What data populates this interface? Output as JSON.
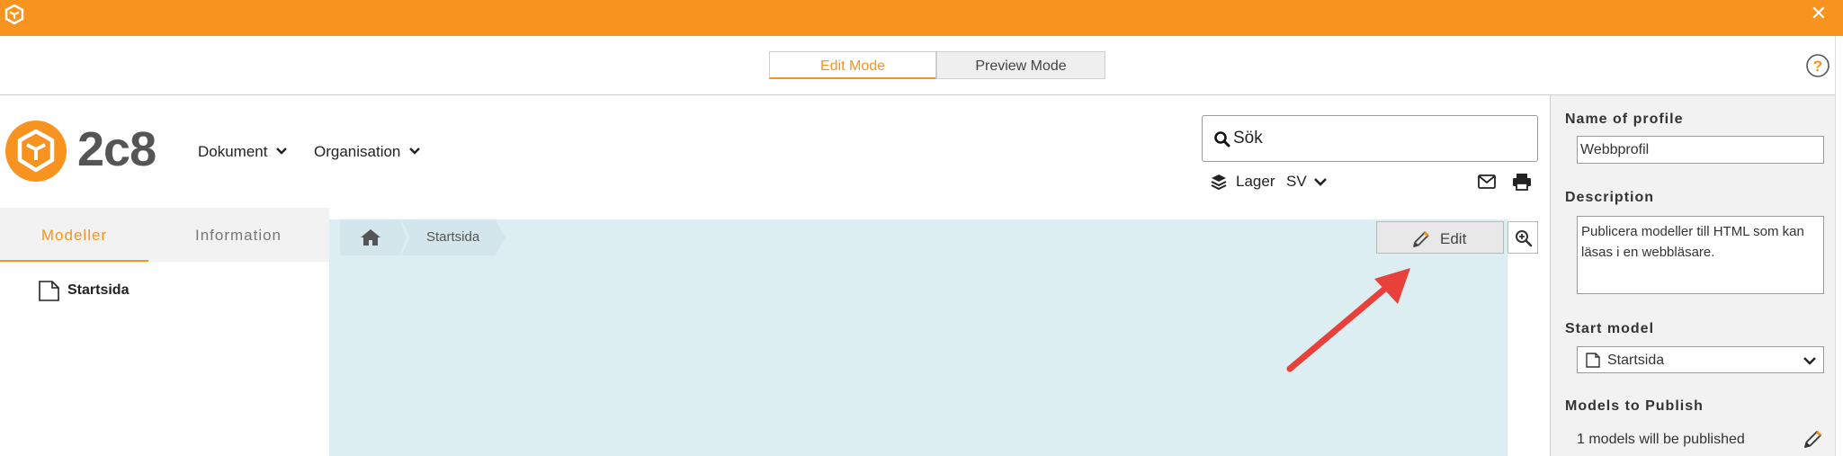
{
  "app": {
    "brand_name": "2c8",
    "accent_color": "#f7931e",
    "close_icon": "close-icon"
  },
  "modes": {
    "edit_label": "Edit Mode",
    "preview_label": "Preview Mode",
    "active": "Edit Mode"
  },
  "header": {
    "nav": [
      {
        "label": "Dokument"
      },
      {
        "label": "Organisation"
      }
    ],
    "search": {
      "placeholder": "Sök",
      "value": ""
    },
    "layers_label": "Lager",
    "language": "SV"
  },
  "sidebar": {
    "tabs": [
      {
        "label": "Modeller",
        "active": true
      },
      {
        "label": "Information",
        "active": false
      }
    ],
    "tree": [
      {
        "label": "Startsida",
        "icon": "document-icon"
      }
    ]
  },
  "content": {
    "breadcrumb": [
      {
        "label": "home",
        "icon": "home-icon"
      },
      {
        "label": "Startsida"
      }
    ],
    "edit_label": "Edit",
    "background_color": "#ddeef2"
  },
  "profile_panel": {
    "name_label": "Name of profile",
    "name_value": "Webbprofil",
    "description_label": "Description",
    "description_value": "Publicera modeller till HTML som kan läsas i en webbläsare.",
    "start_model_label": "Start model",
    "start_model_value": "Startsida",
    "models_label": "Models to Publish",
    "models_text": "1 models will be published"
  }
}
